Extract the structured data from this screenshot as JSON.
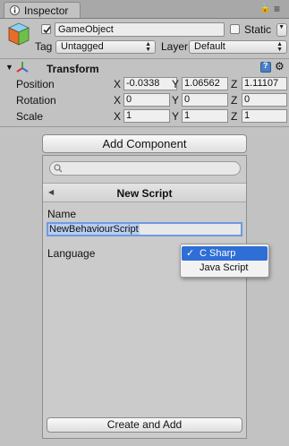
{
  "tab": {
    "label": "Inspector",
    "icon": "info-icon"
  },
  "tab_buttons": {
    "lock": "🔒",
    "menu": "≡"
  },
  "gameobject": {
    "active": true,
    "name": "GameObject",
    "static_label": "Static",
    "static_checked": false,
    "tag_label": "Tag",
    "tag_value": "Untagged",
    "layer_label": "Layer",
    "layer_value": "Default"
  },
  "transform": {
    "title": "Transform",
    "rows": [
      {
        "label": "Position",
        "x": "-0.0338",
        "y": "1.06562",
        "z": "1.11107"
      },
      {
        "label": "Rotation",
        "x": "0",
        "y": "0",
        "z": "0"
      },
      {
        "label": "Scale",
        "x": "1",
        "y": "1",
        "z": "1"
      }
    ],
    "axis": {
      "x": "X",
      "y": "Y",
      "z": "Z"
    }
  },
  "add_component": {
    "label": "Add Component"
  },
  "new_script": {
    "search_value": "",
    "header": "New Script",
    "name_label": "Name",
    "name_value": "NewBehaviourScript",
    "language_label": "Language",
    "create_label": "Create and Add"
  },
  "language_menu": {
    "options": [
      "C Sharp",
      "Java Script"
    ],
    "selected": "C Sharp",
    "check": "✓"
  },
  "colors": {
    "selection": "#2f6ed6",
    "background": "#c2c2c2"
  }
}
